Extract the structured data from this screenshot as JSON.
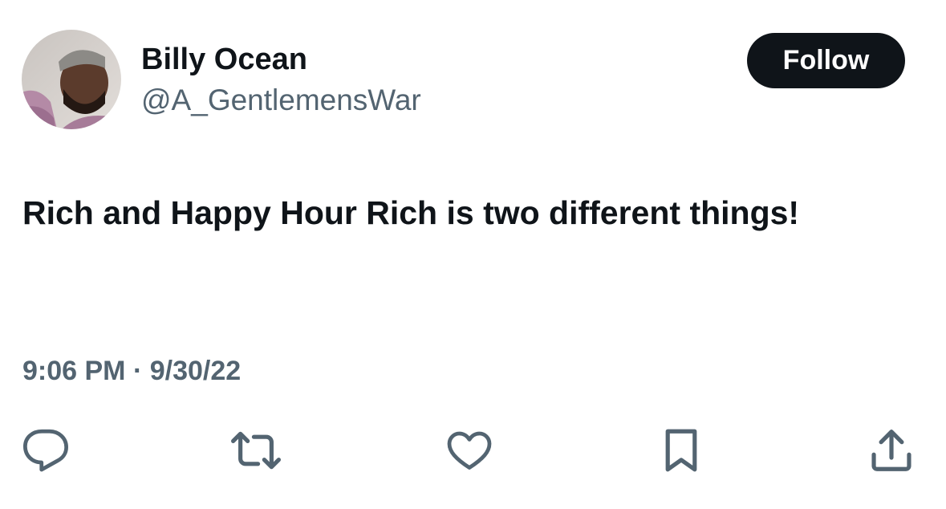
{
  "author": {
    "display_name": "Billy Ocean",
    "handle": "@A_GentlemensWar"
  },
  "follow_button": {
    "label": "Follow"
  },
  "tweet": {
    "text": "Rich and Happy Hour Rich is two different things!",
    "timestamp": "9:06 PM · 9/30/22"
  },
  "actions": {
    "icons": [
      "reply-icon",
      "retweet-icon",
      "like-icon",
      "bookmark-icon",
      "share-icon"
    ]
  },
  "colors": {
    "text_primary": "#0f1419",
    "text_secondary": "#536471",
    "button_bg": "#0f1419",
    "button_text": "#ffffff",
    "background": "#ffffff"
  }
}
